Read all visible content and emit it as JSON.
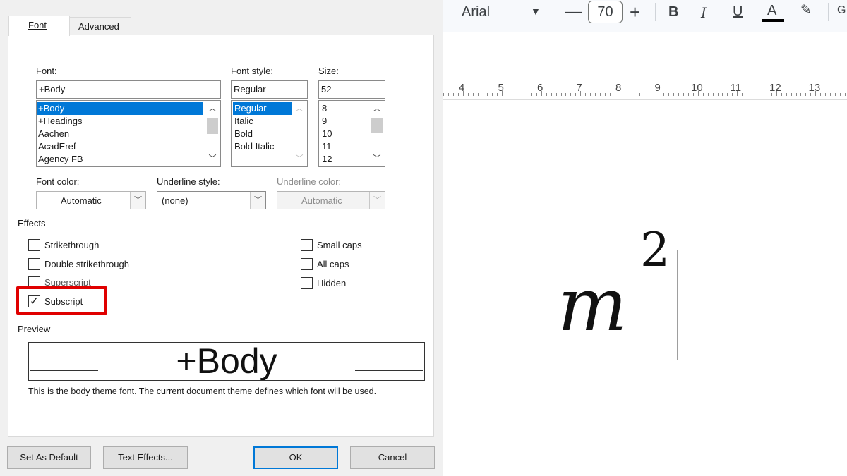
{
  "dialog": {
    "tabs": [
      {
        "label": "Font",
        "active": true
      },
      {
        "label": "Advanced",
        "active": false
      }
    ],
    "font_label": "Font:",
    "font_value": "+Body",
    "font_list": [
      "+Body",
      "+Headings",
      "Aachen",
      "AcadEref",
      "Agency FB"
    ],
    "font_selected": "+Body",
    "style_label": "Font style:",
    "style_value": "Regular",
    "style_list": [
      "Regular",
      "Italic",
      "Bold",
      "Bold Italic"
    ],
    "size_label": "Size:",
    "size_value": "52",
    "size_list": [
      "8",
      "9",
      "10",
      "11",
      "12"
    ],
    "font_color_label": "Font color:",
    "font_color_value": "Automatic",
    "underline_style_label": "Underline style:",
    "underline_style_value": "(none)",
    "underline_color_label": "Underline color:",
    "underline_color_value": "Automatic",
    "effects_label": "Effects",
    "effects_left": [
      {
        "label": "Strikethrough",
        "checked": false
      },
      {
        "label": "Double strikethrough",
        "checked": false
      },
      {
        "label": "Superscript",
        "checked": false
      },
      {
        "label": "Subscript",
        "checked": true
      }
    ],
    "effects_right": [
      {
        "label": "Small caps",
        "checked": false
      },
      {
        "label": "All caps",
        "checked": false
      },
      {
        "label": "Hidden",
        "checked": false
      }
    ],
    "preview_label": "Preview",
    "preview_text": "+Body",
    "preview_note": "This is the body theme font. The current document theme defines which font will be used.",
    "buttons": {
      "set_default": "Set As Default",
      "text_effects": "Text Effects...",
      "ok": "OK",
      "cancel": "Cancel"
    },
    "highlight_color": "#e00000",
    "selection_color": "#0078d7"
  },
  "editor": {
    "font_name": "Arial",
    "font_size": "70",
    "ruler_numbers": [
      "4",
      "5",
      "6",
      "7",
      "8",
      "9",
      "10",
      "11",
      "12",
      "13"
    ],
    "math_base": "m",
    "math_exponent": "2"
  }
}
